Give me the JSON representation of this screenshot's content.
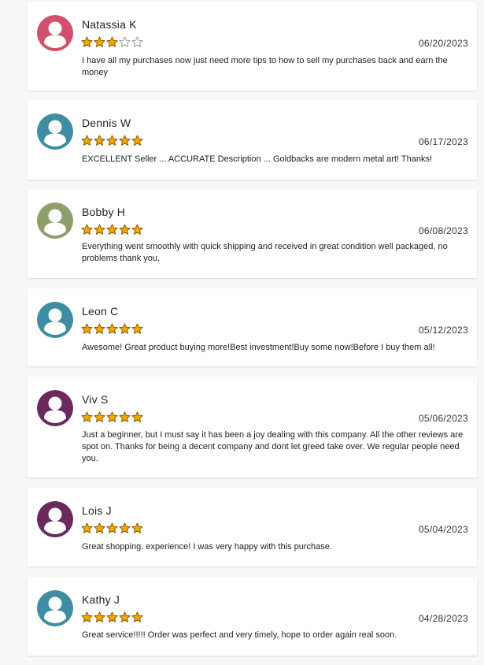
{
  "reviews": [
    {
      "name": "Natassia K",
      "rating": 3,
      "date": "06/20/2023",
      "text": "I have all my purchases now just need more tips to how to sell my purchases back and earn the money",
      "avatar_color": "#d2506b"
    },
    {
      "name": "Dennis W",
      "rating": 5,
      "date": "06/17/2023",
      "text": "EXCELLENT Seller ... ACCURATE Description ... Goldbacks are modern metal art! Thanks!",
      "avatar_color": "#3e8da3"
    },
    {
      "name": "Bobby H",
      "rating": 5,
      "date": "06/08/2023",
      "text": "Everything went smoothly with quick shipping and received in great condition well packaged, no problems thank you.",
      "avatar_color": "#8f9e6b"
    },
    {
      "name": "Leon C",
      "rating": 5,
      "date": "05/12/2023",
      "text": "Awesome! Great product buying more!Best investment!Buy some now!Before I buy them all!",
      "avatar_color": "#3e8da3"
    },
    {
      "name": "Viv S",
      "rating": 5,
      "date": "05/06/2023",
      "text": "Just a beginner, but I must say it has been a joy dealing with this company. All the other reviews are spot on. Thanks for being a decent company and dont let greed take over. We regular people need you.",
      "avatar_color": "#6b2a5e"
    },
    {
      "name": "Lois J",
      "rating": 5,
      "date": "05/04/2023",
      "text": "Great shopping. experience! I was very happy with this purchase.",
      "avatar_color": "#6b2a5e"
    },
    {
      "name": "Kathy J",
      "rating": 5,
      "date": "04/28/2023",
      "text": "Great service!!!!! Order was perfect and very timely, hope to order again real soon.",
      "avatar_color": "#3e8da3"
    }
  ],
  "star_colors": {
    "filled": "#f2a900",
    "filled_stroke": "#8a5a00",
    "empty_stroke": "#9a9a9a"
  }
}
